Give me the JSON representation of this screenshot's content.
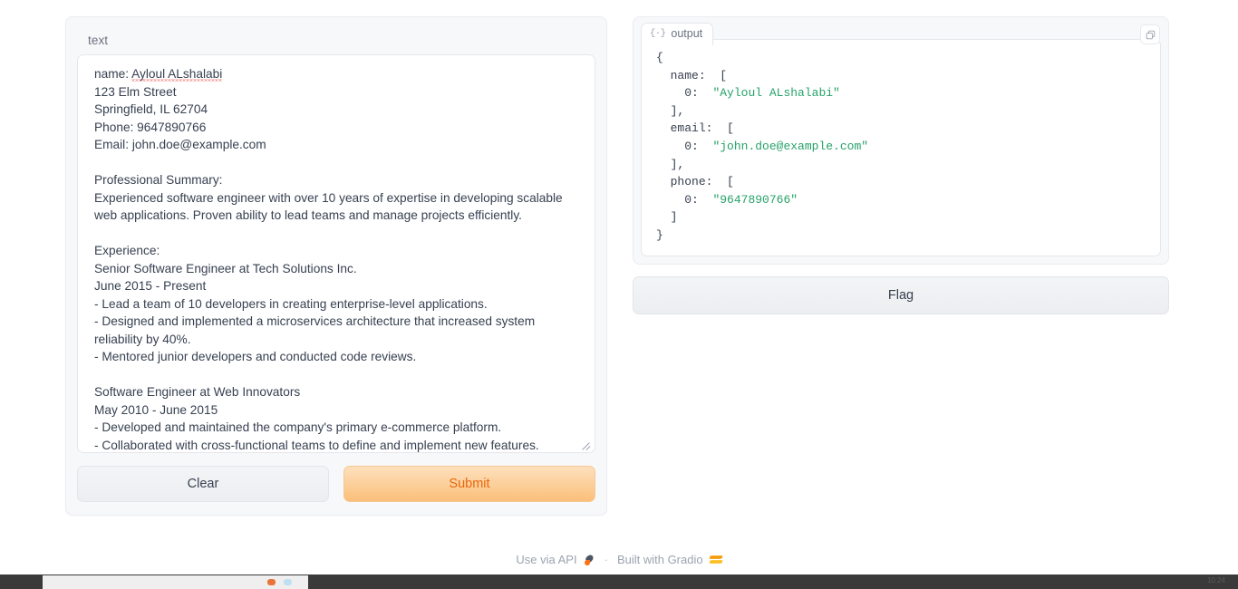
{
  "input_block": {
    "label": "text",
    "textarea_value": "name: Ayloul ALshalabi\n123 Elm Street\nSpringfield, IL 62704\nPhone: 9647890766\nEmail: john.doe@example.com\n\nProfessional Summary:\nExperienced software engineer with over 10 years of expertise in developing scalable web applications. Proven ability to lead teams and manage projects efficiently.\n\nExperience:\nSenior Software Engineer at Tech Solutions Inc.\nJune 2015 - Present\n- Lead a team of 10 developers in creating enterprise-level applications.\n- Designed and implemented a microservices architecture that increased system reliability by 40%.\n- Mentored junior developers and conducted code reviews.\n\nSoftware Engineer at Web Innovators\nMay 2010 - June 2015\n- Developed and maintained the company's primary e-commerce platform.\n- Collaborated with cross-functional teams to define and implement new features.",
    "misspelled_word": "Ayloul ALshalabi",
    "resize_handle_icon": "resize-grip-icon"
  },
  "buttons": {
    "clear_label": "Clear",
    "submit_label": "Submit",
    "flag_label": "Flag",
    "submit_text_color": "#e8670c",
    "submit_bg_top": "#fde0bd",
    "submit_bg_bottom": "#fbbf7a"
  },
  "output_block": {
    "tab_label": "output",
    "tab_icon": "json-braces-icon",
    "copy_icon": "copy-icon",
    "json_lines": [
      {
        "indent": 0,
        "key": "",
        "punc": "{",
        "value": ""
      },
      {
        "indent": 1,
        "key": "name:",
        "punc": "[",
        "value": ""
      },
      {
        "indent": 2,
        "key": "0:",
        "punc": "",
        "value": "\"Ayloul ALshalabi\""
      },
      {
        "indent": 1,
        "key": "",
        "punc": "],",
        "value": ""
      },
      {
        "indent": 1,
        "key": "email:",
        "punc": "[",
        "value": ""
      },
      {
        "indent": 2,
        "key": "0:",
        "punc": "",
        "value": "\"john.doe@example.com\""
      },
      {
        "indent": 1,
        "key": "",
        "punc": "],",
        "value": ""
      },
      {
        "indent": 1,
        "key": "phone:",
        "punc": "[",
        "value": ""
      },
      {
        "indent": 2,
        "key": "0:",
        "punc": "",
        "value": "\"9647890766\""
      },
      {
        "indent": 1,
        "key": "",
        "punc": "]",
        "value": ""
      },
      {
        "indent": 0,
        "key": "",
        "punc": "}",
        "value": ""
      }
    ],
    "string_color": "#26a269",
    "key_color": "#374151"
  },
  "footer": {
    "api_label": "Use via API",
    "api_icon": "rocket-icon",
    "separator": "·",
    "built_with_label": "Built with Gradio",
    "gradio_logo_icon": "gradio-logo-icon"
  },
  "taskbar": {
    "clock": "10:24",
    "icon_one": "firefox-icon",
    "icon_two": "cloud-icon"
  }
}
